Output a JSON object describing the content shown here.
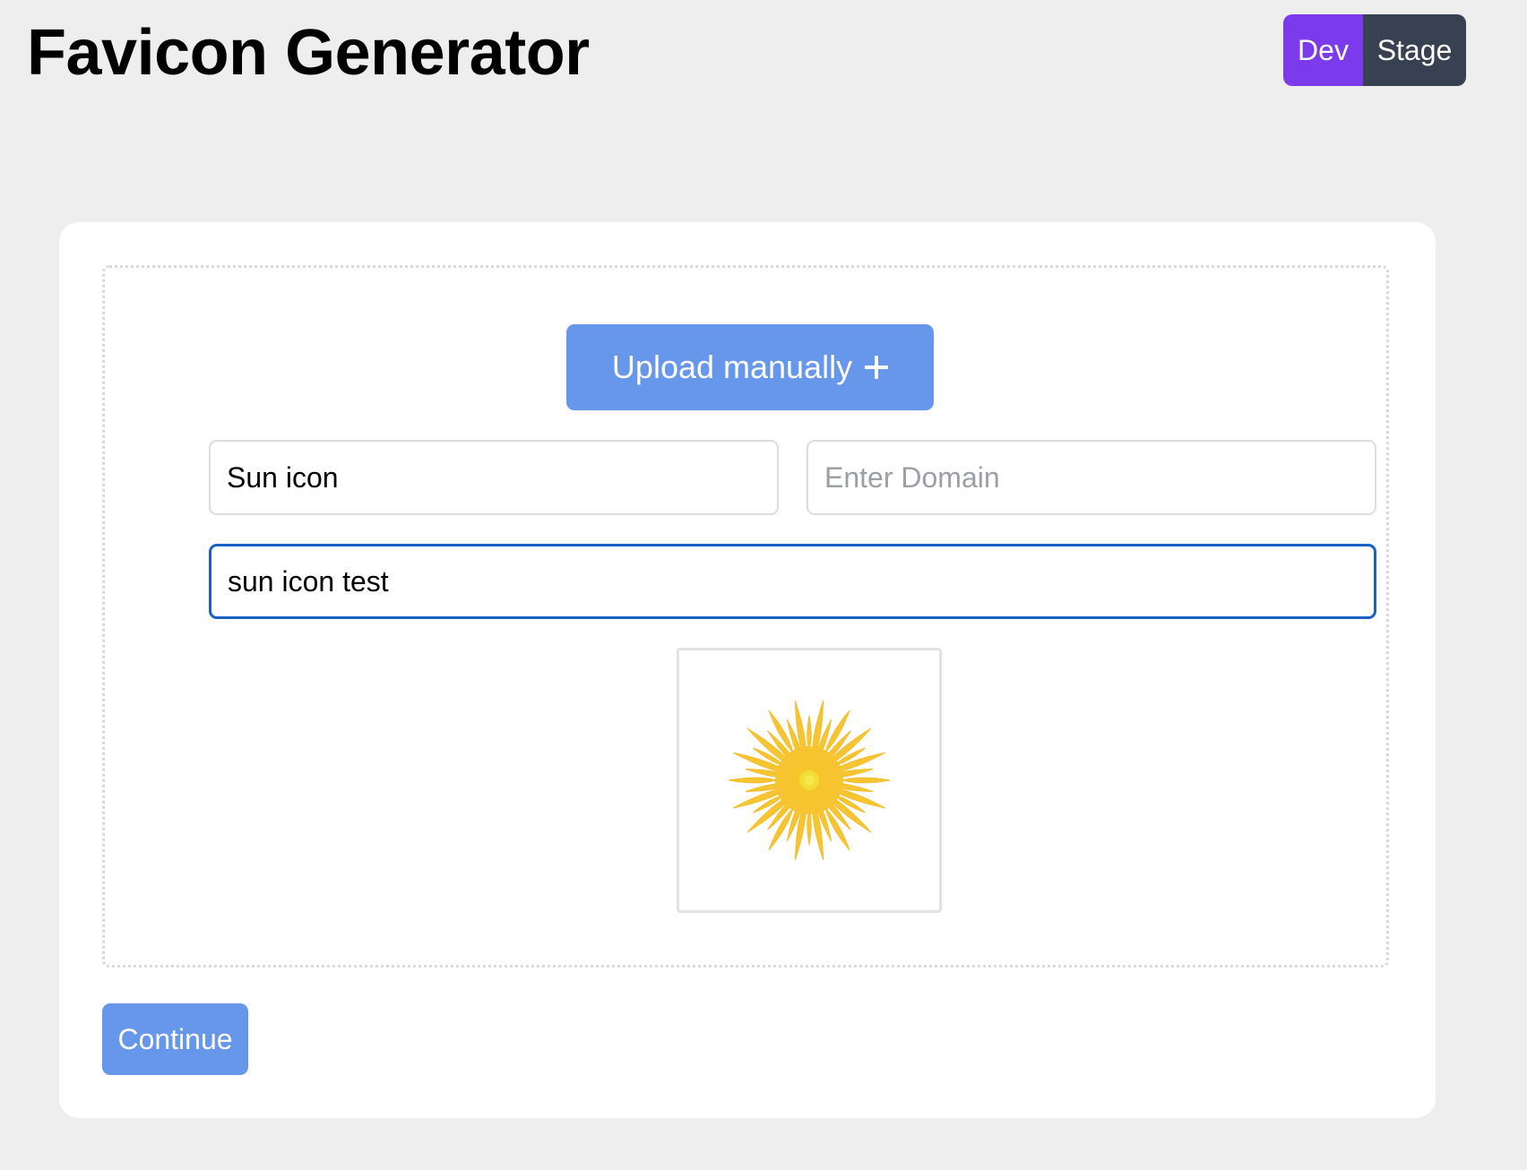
{
  "header": {
    "title": "Favicon Generator"
  },
  "env_switch": {
    "options": [
      "Dev",
      "Stage"
    ],
    "active": "Dev",
    "active_color": "#7c3aed",
    "inactive_color": "#374151"
  },
  "upload": {
    "label": "Upload manually",
    "icon": "plus-icon",
    "color": "#6797eb"
  },
  "form": {
    "name_value": "Sun icon",
    "domain_value": "",
    "domain_placeholder": "Enter Domain",
    "prompt_value": "sun icon test"
  },
  "preview": {
    "icon": "sun-icon",
    "alt": "Generated favicon preview"
  },
  "actions": {
    "continue_label": "Continue"
  }
}
